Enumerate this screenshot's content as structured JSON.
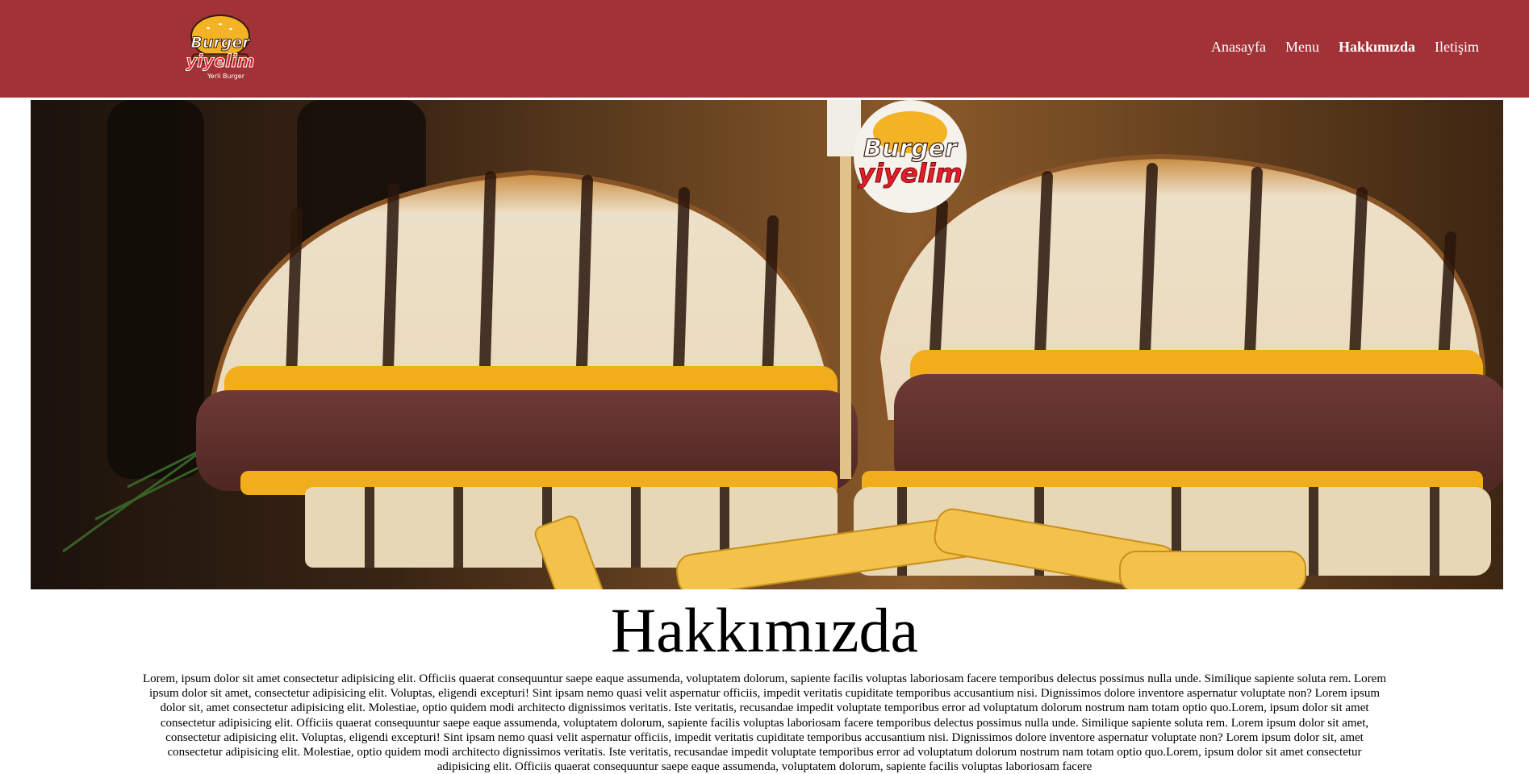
{
  "brand": {
    "logo_word1": "Burger",
    "logo_word2": "yiyelim",
    "logo_tagline": "Yerli Burger",
    "primary_color": "#a13237"
  },
  "nav": {
    "items": [
      {
        "label": "Anasayfa",
        "active": false
      },
      {
        "label": "Menu",
        "active": false
      },
      {
        "label": "Hakkımızda",
        "active": true
      },
      {
        "label": "Iletişim",
        "active": false
      }
    ]
  },
  "hero": {
    "flag_word1": "Burger",
    "flag_word2": "yiyelim"
  },
  "about": {
    "title": "Hakkımızda",
    "body": "Lorem, ipsum dolor sit amet consectetur adipisicing elit. Officiis quaerat consequuntur saepe eaque assumenda, voluptatem dolorum, sapiente facilis voluptas laboriosam facere temporibus delectus possimus nulla unde. Similique sapiente soluta rem. Lorem ipsum dolor sit amet, consectetur adipisicing elit. Voluptas, eligendi excepturi! Sint ipsam nemo quasi velit aspernatur officiis, impedit veritatis cupiditate temporibus accusantium nisi. Dignissimos dolore inventore aspernatur voluptate non? Lorem ipsum dolor sit, amet consectetur adipisicing elit. Molestiae, optio quidem modi architecto dignissimos veritatis. Iste veritatis, recusandae impedit voluptate temporibus error ad voluptatum dolorum nostrum nam totam optio quo.Lorem, ipsum dolor sit amet consectetur adipisicing elit. Officiis quaerat consequuntur saepe eaque assumenda, voluptatem dolorum, sapiente facilis voluptas laboriosam facere temporibus delectus possimus nulla unde. Similique sapiente soluta rem. Lorem ipsum dolor sit amet, consectetur adipisicing elit. Voluptas, eligendi excepturi! Sint ipsam nemo quasi velit aspernatur officiis, impedit veritatis cupiditate temporibus accusantium nisi. Dignissimos dolore inventore aspernatur voluptate non? Lorem ipsum dolor sit, amet consectetur adipisicing elit. Molestiae, optio quidem modi architecto dignissimos veritatis. Iste veritatis, recusandae impedit voluptate temporibus error ad voluptatum dolorum nostrum nam totam optio quo.Lorem, ipsum dolor sit amet consectetur adipisicing elit. Officiis quaerat consequuntur saepe eaque assumenda, voluptatem dolorum, sapiente facilis voluptas laboriosam facere"
  }
}
